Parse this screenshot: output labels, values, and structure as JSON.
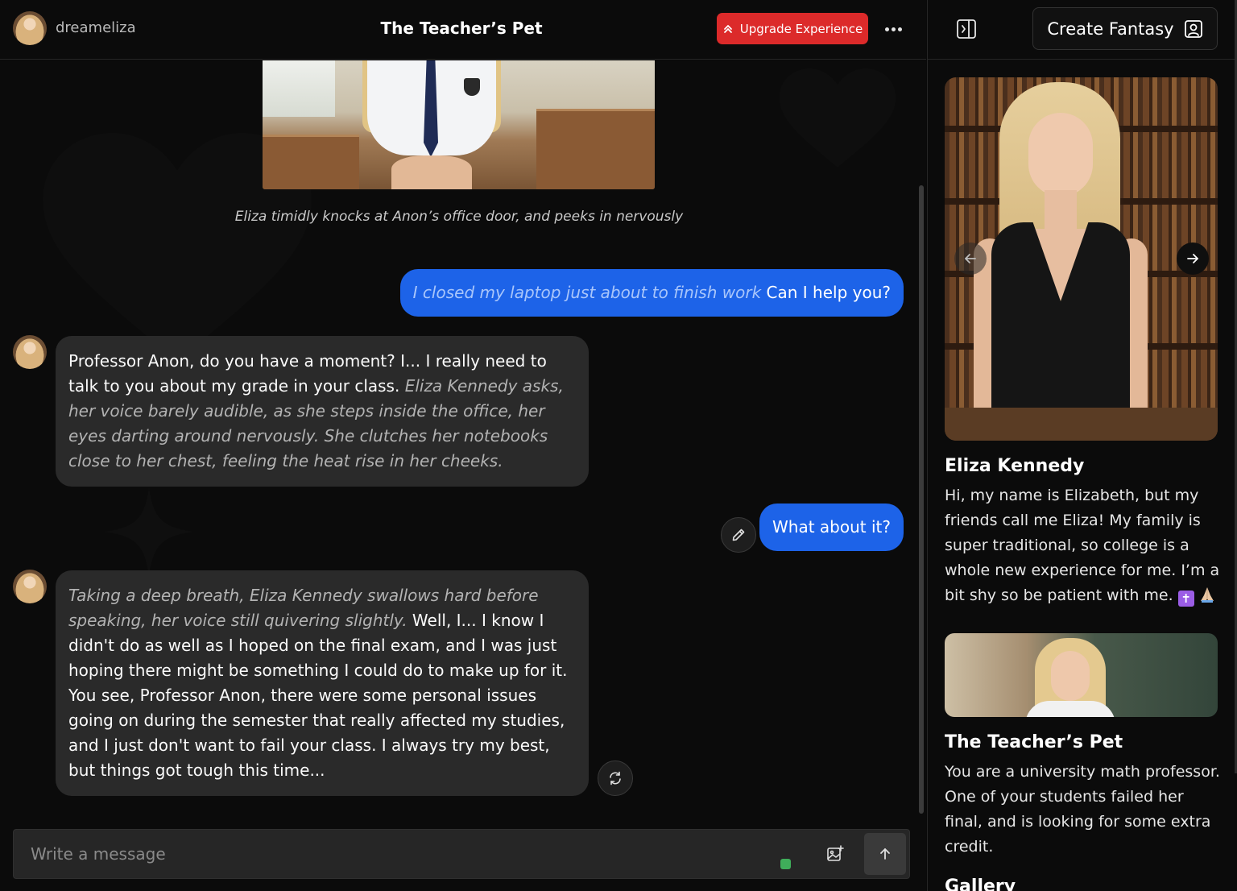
{
  "header": {
    "username": "dreameliza",
    "title": "The Teacher’s Pet",
    "upgrade_label": "Upgrade Experience"
  },
  "chat": {
    "scene_caption": "Eliza timidly knocks at Anon’s office door, and peeks in nervously",
    "messages": [
      {
        "role": "user",
        "action": "I closed my laptop just about to finish work",
        "text": "Can I help you?"
      },
      {
        "role": "bot",
        "text": "Professor Anon, do you have a moment? I... I really need to talk to you about my grade in your class.",
        "action": "Eliza Kennedy asks, her voice barely audible, as she steps inside the office, her eyes darting around nervously. She clutches her notebooks close to her chest, feeling the heat rise in her cheeks."
      },
      {
        "role": "user",
        "text": "What about it?"
      },
      {
        "role": "bot",
        "action": "Taking a deep breath, Eliza Kennedy swallows hard before speaking, her voice still quivering slightly.",
        "text": "Well, I... I know I didn't do as well as I hoped on the final exam, and I was just hoping there might be something I could do to make up for it. You see, Professor Anon, there were some personal issues going on during the semester that really affected my studies, and I just don't want to fail your class. I always try my best, but things got tough this time..."
      }
    ],
    "composer_placeholder": "Write a message"
  },
  "sidebar": {
    "create_label": "Create Fantasy",
    "character": {
      "name": "Eliza Kennedy",
      "bio": "Hi, my name is Elizabeth, but my friends call me Eliza! My family is super traditional, so college is a whole new experience for me. I’m a bit shy so be patient with me."
    },
    "scenario": {
      "name": "The Teacher’s Pet",
      "description": "You are a university math professor. One of your students failed her final, and is looking for some extra credit."
    },
    "gallery_title": "Gallery"
  },
  "colors": {
    "accent_blue": "#1d63e8",
    "upgrade_red": "#dc2a2a",
    "bot_bubble": "#2a2a2a",
    "status_green": "#3fae5a"
  },
  "icons": [
    "upgrade-chevrons-icon",
    "more-dots-icon",
    "panel-toggle-icon",
    "user-square-icon",
    "arrow-left-icon",
    "arrow-right-icon",
    "pencil-icon",
    "refresh-icon",
    "image-plus-icon",
    "arrow-up-icon"
  ]
}
